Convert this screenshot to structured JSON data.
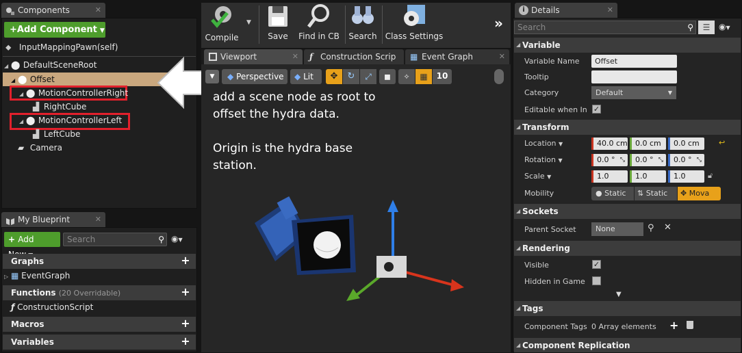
{
  "components": {
    "tab_title": "Components",
    "add_button": "+Add Component",
    "self_item": "InputMappingPawn(self)",
    "tree": [
      {
        "label": "DefaultSceneRoot",
        "level": 0
      },
      {
        "label": "Offset",
        "level": 1,
        "selected": true
      },
      {
        "label": "MotionControllerRight",
        "level": 2,
        "highlight": true
      },
      {
        "label": "RightCube",
        "level": 3
      },
      {
        "label": "MotionControllerLeft",
        "level": 2,
        "highlight": true
      },
      {
        "label": "LeftCube",
        "level": 3
      },
      {
        "label": "Camera",
        "level": 1
      }
    ]
  },
  "blueprint": {
    "tab_title": "My Blueprint",
    "add_new": "Add New",
    "search_placeholder": "Search",
    "sections": {
      "graphs": "Graphs",
      "event_graph": "EventGraph",
      "functions": "Functions",
      "functions_note": "(20 Overridable)",
      "construction_script": "ConstructionScript",
      "macros": "Macros",
      "variables": "Variables"
    }
  },
  "toolbar": {
    "compile": "Compile",
    "save": "Save",
    "find": "Find in CB",
    "search": "Search",
    "class_settings": "Class Settings",
    "more": "»"
  },
  "editor_tabs": {
    "viewport": "Viewport",
    "construction": "Construction Scrip",
    "event_graph": "Event Graph"
  },
  "viewport": {
    "perspective": "Perspective",
    "lit": "Lit",
    "grid_value": "10",
    "annotation_line1": "add a scene node as root to",
    "annotation_line2": "offset the hydra data.",
    "annotation_line3": "Origin is the hydra base",
    "annotation_line4": "station."
  },
  "details": {
    "tab_title": "Details",
    "search_placeholder": "Search",
    "variable": {
      "section": "Variable",
      "name_label": "Variable Name",
      "name_value": "Offset",
      "tooltip_label": "Tooltip",
      "tooltip_value": "",
      "category_label": "Category",
      "category_value": "Default",
      "editable_label": "Editable when Inhe"
    },
    "transform": {
      "section": "Transform",
      "location_label": "Location",
      "location": [
        "40.0 cm",
        "0.0 cm",
        "0.0 cm"
      ],
      "rotation_label": "Rotation",
      "rotation": [
        "0.0 °",
        "0.0 °",
        "0.0 °"
      ],
      "scale_label": "Scale",
      "scale": [
        "1.0",
        "1.0",
        "1.0"
      ],
      "mobility_label": "Mobility",
      "mobility": [
        "Static",
        "Static",
        "Mova"
      ]
    },
    "sockets": {
      "section": "Sockets",
      "parent_label": "Parent Socket",
      "parent_value": "None"
    },
    "rendering": {
      "section": "Rendering",
      "visible_label": "Visible",
      "hidden_label": "Hidden in Game"
    },
    "tags": {
      "section": "Tags",
      "component_tags_label": "Component Tags",
      "component_tags_value": "0 Array elements"
    },
    "replication": {
      "section": "Component Replication"
    }
  },
  "colors": {
    "accent_green": "#4e9d2c",
    "selection": "#c9a77e",
    "highlight_red": "#e2202c",
    "movable": "#e8a11a"
  }
}
